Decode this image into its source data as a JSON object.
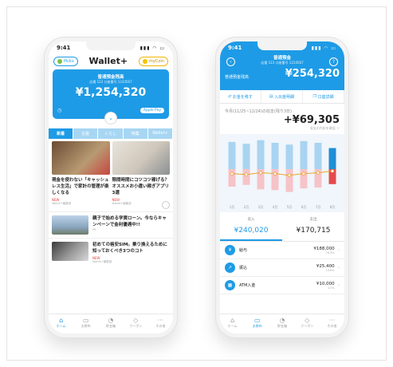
{
  "left": {
    "time": "9:41",
    "header": {
      "picks_label": "Picks",
      "logo": "Wallet+",
      "coin_label": "myCoin"
    },
    "card": {
      "title": "普通預金残高",
      "subtitle": "店番 123 口座番号 1234567",
      "amount": "¥1,254,320",
      "apple_pay": "Apple Pay"
    },
    "tabs": [
      "新着",
      "お金",
      "くらし",
      "特集",
      "Wallet+"
    ],
    "articles": [
      {
        "title": "現金を使わない「キャッシュレス生活」で家計の管理が楽しくなる",
        "badge": "NEW",
        "source": "Wallet+編集部"
      },
      {
        "title": "隙間時間にコツコツ稼げる？ オススメお小遣い稼ぎアプリ3選",
        "badge": "NEW",
        "source": "Wallet+編集部"
      }
    ],
    "rows": [
      {
        "title": "親子で始める学資ローン。今ならキャンペーンで金利優遇中!!",
        "source": "PR"
      },
      {
        "title": "初めての格安SIM。乗り換えるために知っておくべき3つのコト",
        "badge": "NEW",
        "source": "Wallet+編集部"
      }
    ],
    "tabbar": [
      {
        "label": "ホーム",
        "icon": "home-icon"
      },
      {
        "label": "お財布",
        "icon": "wallet-icon"
      },
      {
        "label": "貯金箱",
        "icon": "piggy-icon"
      },
      {
        "label": "クーポン",
        "icon": "coupon-icon"
      },
      {
        "label": "その他",
        "icon": "more-icon"
      }
    ]
  },
  "right": {
    "time": "9:41",
    "title": "普通預金",
    "subtitle": "店番 123 口座番号 1234567",
    "balance_label": "普通預金残高",
    "balance": "¥254,320",
    "actions": [
      "お金を移す",
      "入出金明細",
      "口座詳細"
    ],
    "period": "今月(11/25~12/24)の収支(残り3日)",
    "net": "+¥69,305",
    "net_note": "収支の内訳を確認 ＞",
    "chart_data": {
      "type": "bar",
      "categories": [
        "1月",
        "2月",
        "3月",
        "4月",
        "5月",
        "6月",
        "7月",
        "8月"
      ],
      "series": [
        {
          "name": "収入",
          "values": [
            310000,
            290000,
            330000,
            300000,
            280000,
            320000,
            300000,
            240020
          ]
        },
        {
          "name": "支出",
          "values": [
            200000,
            180000,
            230000,
            240000,
            260000,
            220000,
            210000,
            170715
          ]
        }
      ],
      "balance_line": [
        40000,
        30000,
        50000,
        40000,
        20000,
        40000,
        50000,
        69305
      ]
    },
    "summary": {
      "income_label": "収入",
      "income": "¥240,020",
      "expense_label": "支出",
      "expense": "¥170,715"
    },
    "transactions": [
      {
        "name": "給与",
        "amount": "¥188,000",
        "pct": "78.3%"
      },
      {
        "name": "振込",
        "amount": "¥25,400",
        "pct": "10.6%"
      },
      {
        "name": "ATM入金",
        "amount": "¥10,000",
        "pct": "4.2%"
      }
    ],
    "tabbar": [
      "ホーム",
      "お財布",
      "貯金箱",
      "クーポン",
      "その他"
    ]
  }
}
